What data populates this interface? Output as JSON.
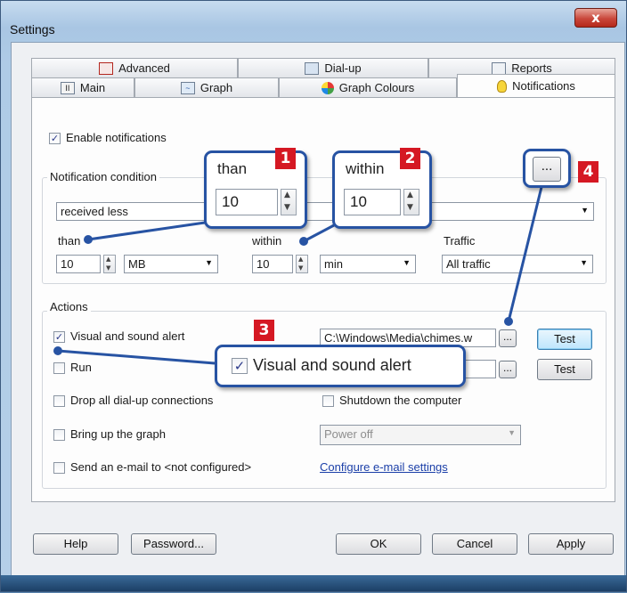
{
  "window": {
    "title": "Settings",
    "close_glyph": "x"
  },
  "tabs": {
    "row_top": [
      {
        "label": "Advanced",
        "icon": "calendar-icon"
      },
      {
        "label": "Dial-up",
        "icon": "modem-icon"
      },
      {
        "label": "Reports",
        "icon": "report-icon"
      }
    ],
    "row_bottom": [
      {
        "label": "Main",
        "icon": "main-icon"
      },
      {
        "label": "Graph",
        "icon": "graph-icon"
      },
      {
        "label": "Graph Colours",
        "icon": "palette-icon"
      },
      {
        "label": "Notifications",
        "icon": "lightbulb-icon",
        "active": true
      }
    ]
  },
  "notifications": {
    "enable_label": "Enable notifications",
    "enable_checked": true,
    "condition_group": "Notification condition",
    "condition_value": "received less",
    "than_label": "than",
    "than_value": "10",
    "than_unit": "MB",
    "within_label": "within",
    "within_value": "10",
    "within_unit": "min",
    "traffic_label": "Traffic",
    "traffic_value": "All traffic"
  },
  "actions": {
    "group": "Actions",
    "visual_label": "Visual and sound alert",
    "visual_checked": true,
    "sound_path": "C:\\Windows\\Media\\chimes.w",
    "browse_label": "...",
    "test_label": "Test",
    "run_label": "Run",
    "run_checked": false,
    "drop_label": "Drop all dial-up connections",
    "shutdown_label": "Shutdown the computer",
    "graph_label": "Bring up the graph",
    "power_value": "Power off",
    "email_label": "Send an e-mail to <not configured>",
    "email_link": "Configure e-mail settings"
  },
  "buttons": {
    "help": "Help",
    "password": "Password...",
    "ok": "OK",
    "cancel": "Cancel",
    "apply": "Apply"
  },
  "callouts": {
    "c1": {
      "number": "1",
      "label": "than",
      "value": "10"
    },
    "c2": {
      "number": "2",
      "label": "within",
      "value": "10"
    },
    "c3": {
      "number": "3",
      "label": "Visual and sound alert"
    },
    "c4": {
      "number": "4",
      "label": "..."
    }
  },
  "colors": {
    "callout_border": "#2753a3",
    "badge": "#d51823",
    "close_button": "#c9473b"
  }
}
